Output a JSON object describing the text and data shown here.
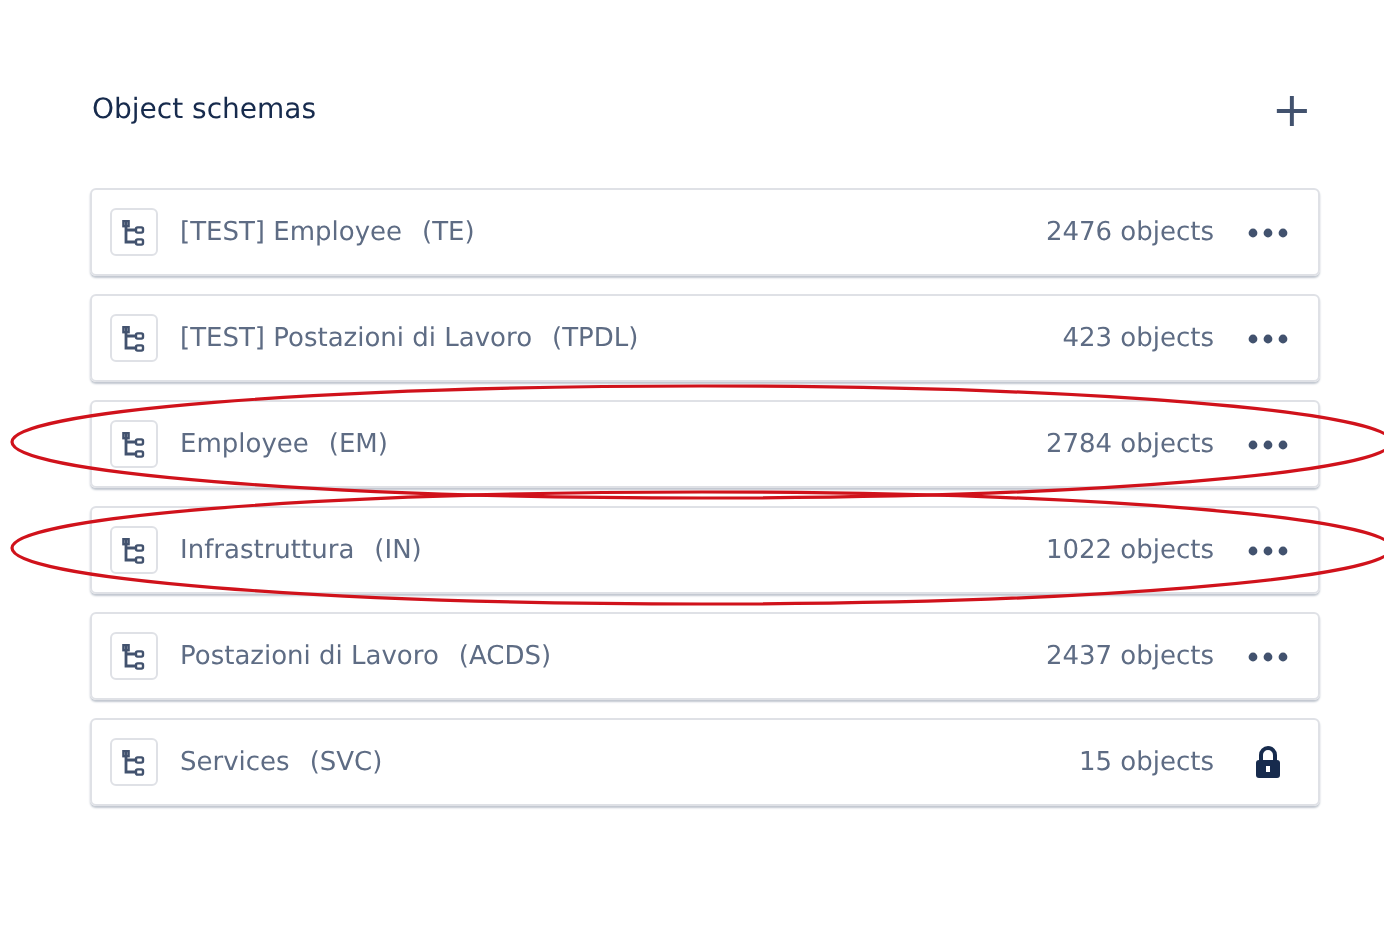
{
  "header": {
    "title": "Object schemas",
    "add_button": "+"
  },
  "schemas": [
    {
      "name": "[TEST] Employee",
      "key": "(TE)",
      "count": "2476 objects",
      "kind": "menu",
      "circled": false
    },
    {
      "name": "[TEST] Postazioni di Lavoro",
      "key": "(TPDL)",
      "count": "423 objects",
      "kind": "menu",
      "circled": false
    },
    {
      "name": "Employee",
      "key": "(EM)",
      "count": "2784 objects",
      "kind": "menu",
      "circled": true
    },
    {
      "name": "Infrastruttura",
      "key": "(IN)",
      "count": "1022 objects",
      "kind": "menu",
      "circled": true
    },
    {
      "name": "Postazioni di Lavoro",
      "key": "(ACDS)",
      "count": "2437 objects",
      "kind": "menu",
      "circled": false
    },
    {
      "name": "Services",
      "key": "(SVC)",
      "count": "15 objects",
      "kind": "locked",
      "circled": false
    }
  ]
}
